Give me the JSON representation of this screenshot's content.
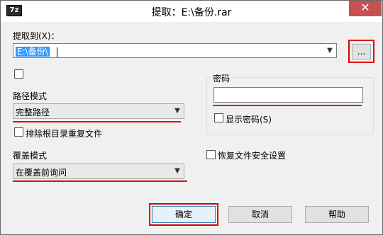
{
  "app_icon_text": "7z",
  "window_title": "提取：E:\\备份.rar",
  "close_glyph": "✕",
  "extract_to": {
    "label": "提取到(X)：",
    "value": "E:\\备份\\",
    "browse_label": "..."
  },
  "path_mode": {
    "label": "路径模式",
    "value": "完整路径"
  },
  "exclude_root": {
    "label": "排除根目录重复文件"
  },
  "password": {
    "group_label": "密码",
    "value": "",
    "show_label": "显示密码(S)"
  },
  "overwrite_mode": {
    "label": "覆盖模式",
    "value": "在覆盖前询问"
  },
  "restore_security": {
    "label": "恢复文件安全设置"
  },
  "buttons": {
    "ok": "确定",
    "cancel": "取消",
    "help": "帮助"
  },
  "colors": {
    "annotation_red": "#e00000",
    "selection_blue": "#3399ff",
    "close_red": "#c75050"
  }
}
